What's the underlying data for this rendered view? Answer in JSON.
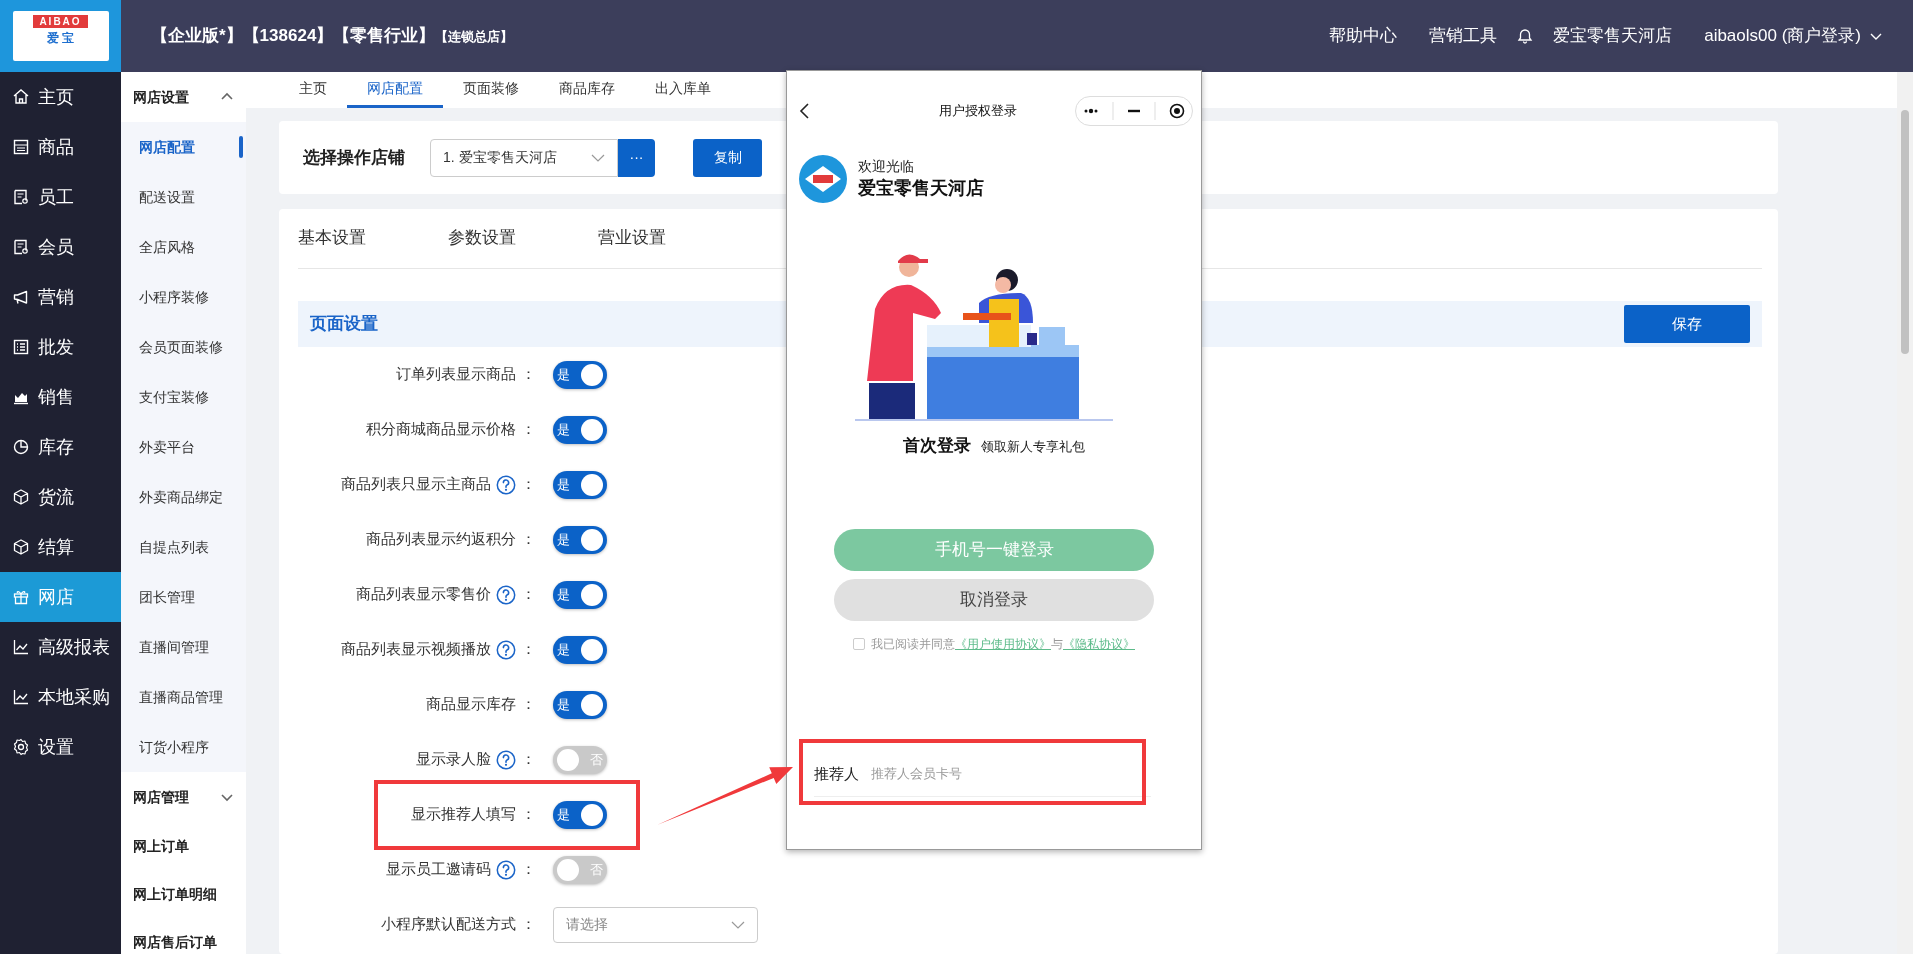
{
  "logo": {
    "top": "AIBAO",
    "bottom": "爱 宝"
  },
  "header": {
    "title_parts": [
      {
        "text": "【企业版*】【138624】【零售行业】",
        "kind": "main"
      },
      {
        "text": "【连锁总店】",
        "kind": "small"
      }
    ],
    "links": [
      "帮助中心",
      "营销工具"
    ],
    "store": "爱宝零售天河店",
    "account": "aibaols00 (商户登录)"
  },
  "sidebar": {
    "items": [
      {
        "label": "主页",
        "selected": false
      },
      {
        "label": "商品",
        "selected": false
      },
      {
        "label": "员工",
        "selected": false
      },
      {
        "label": "会员",
        "selected": false
      },
      {
        "label": "营销",
        "selected": false
      },
      {
        "label": "批发",
        "selected": false
      },
      {
        "label": "销售",
        "selected": false
      },
      {
        "label": "库存",
        "selected": false
      },
      {
        "label": "货流",
        "selected": false
      },
      {
        "label": "结算",
        "selected": false
      },
      {
        "label": "网店",
        "selected": true
      },
      {
        "label": "高级报表",
        "selected": false
      },
      {
        "label": "本地采购",
        "selected": false
      },
      {
        "label": "设置",
        "selected": false
      }
    ]
  },
  "submenu": [
    {
      "kind": "group",
      "label": "网店设置",
      "expanded": true,
      "children": [
        {
          "label": "网店配置",
          "selected": true
        },
        {
          "label": "配送设置",
          "selected": false
        },
        {
          "label": "全店风格",
          "selected": false
        },
        {
          "label": "小程序装修",
          "selected": false
        },
        {
          "label": "会员页面装修",
          "selected": false
        },
        {
          "label": "支付宝装修",
          "selected": false
        },
        {
          "label": "外卖平台",
          "selected": false
        },
        {
          "label": "外卖商品绑定",
          "selected": false
        },
        {
          "label": "自提点列表",
          "selected": false
        },
        {
          "label": "团长管理",
          "selected": false
        },
        {
          "label": "直播间管理",
          "selected": false
        },
        {
          "label": "直播商品管理",
          "selected": false
        },
        {
          "label": "订货小程序",
          "selected": false
        }
      ]
    },
    {
      "kind": "group",
      "label": "网店管理",
      "expanded": false
    },
    {
      "kind": "link",
      "label": "网上订单"
    },
    {
      "kind": "link",
      "label": "网上订单明细"
    },
    {
      "kind": "link",
      "label": "网店售后订单"
    }
  ],
  "tabs": [
    {
      "label": "主页",
      "selected": false
    },
    {
      "label": "网店配置",
      "selected": true
    },
    {
      "label": "页面装修",
      "selected": false
    },
    {
      "label": "商品库存",
      "selected": false
    },
    {
      "label": "出入库单",
      "selected": false
    }
  ],
  "store_picker": {
    "label": "选择操作店铺",
    "value": "1. 爱宝零售天河店",
    "more_button": "···",
    "copy_button": "复制"
  },
  "settings": {
    "tabs": [
      {
        "label": "基本设置",
        "selected": false
      },
      {
        "label": "参数设置",
        "selected": false
      },
      {
        "label": "营业设置",
        "selected": false
      }
    ],
    "section_title": "页面设置",
    "save_button": "保存",
    "rows": [
      {
        "kind": "switch",
        "label": "订单列表显示商品",
        "colon": "：",
        "help": false,
        "on": true,
        "switch_text": "是",
        "highlighted": false
      },
      {
        "kind": "switch",
        "label": "积分商城商品显示价格",
        "colon": "：",
        "help": false,
        "on": true,
        "switch_text": "是",
        "highlighted": false
      },
      {
        "kind": "switch",
        "label": "商品列表只显示主商品",
        "colon": "：",
        "help": true,
        "on": true,
        "switch_text": "是",
        "highlighted": false
      },
      {
        "kind": "switch",
        "label": "商品列表显示约返积分",
        "colon": "：",
        "help": false,
        "on": true,
        "switch_text": "是",
        "highlighted": false
      },
      {
        "kind": "switch",
        "label": "商品列表显示零售价",
        "colon": "：",
        "help": true,
        "on": true,
        "switch_text": "是",
        "highlighted": false
      },
      {
        "kind": "switch",
        "label": "商品列表显示视频播放",
        "colon": "：",
        "help": true,
        "on": true,
        "switch_text": "是",
        "highlighted": false
      },
      {
        "kind": "switch",
        "label": "商品显示库存",
        "colon": "：",
        "help": false,
        "on": true,
        "switch_text": "是",
        "highlighted": false
      },
      {
        "kind": "switch",
        "label": "显示录人脸",
        "colon": "：",
        "help": true,
        "on": false,
        "switch_text": "否",
        "highlighted": false
      },
      {
        "kind": "switch",
        "label": "显示推荐人填写",
        "colon": "：",
        "help": false,
        "on": true,
        "switch_text": "是",
        "highlighted": true
      },
      {
        "kind": "switch",
        "label": "显示员工邀请码",
        "colon": "：",
        "help": true,
        "on": false,
        "switch_text": "否",
        "highlighted": false
      },
      {
        "kind": "select",
        "label": "小程序默认配送方式",
        "colon": "：",
        "help": false,
        "placeholder": "请选择",
        "highlighted": false
      }
    ]
  },
  "phone": {
    "title": "用户授权登录",
    "welcome": "欢迎光临",
    "store": "爱宝零售天河店",
    "promo_title": "首次登录",
    "promo_text": "领取新人专享礼包",
    "primary_button": "手机号一键登录",
    "cancel_button": "取消登录",
    "agreement": {
      "checked": false,
      "text": "我已阅读并同意",
      "link_1": "《用户使用协议》",
      "joiner": "与",
      "link_2": "《隐私协议》"
    },
    "referrer": {
      "label": "推荐人",
      "placeholder": "推荐人会员卡号",
      "highlighted": true
    }
  }
}
